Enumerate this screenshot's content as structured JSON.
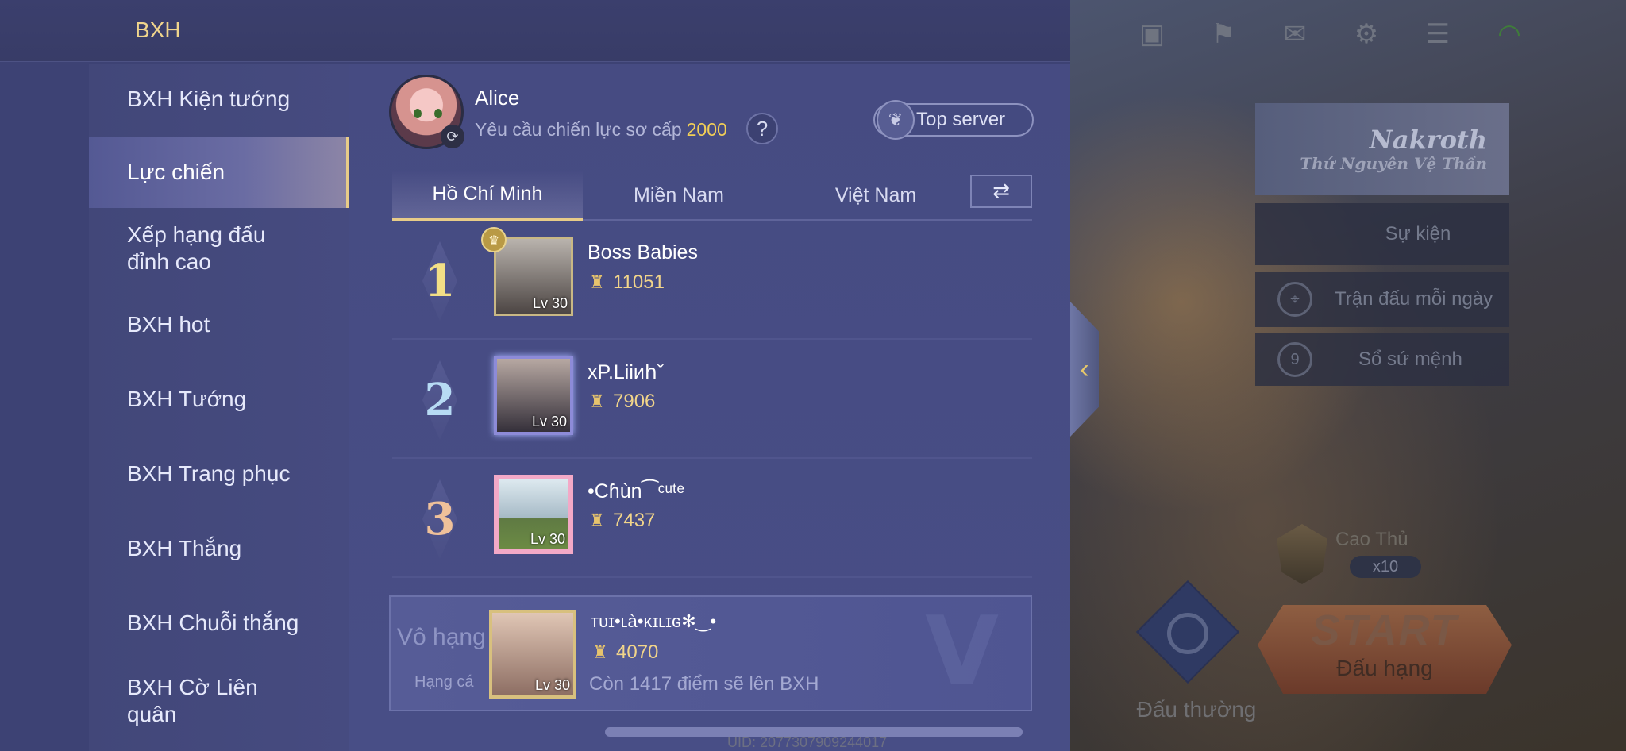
{
  "header": {
    "title": "BXH"
  },
  "sidebar": {
    "items": [
      {
        "label": "BXH Kiện tướng",
        "active": false
      },
      {
        "label": "Lực chiến",
        "active": true
      },
      {
        "label": "Xếp hạng đấu đỉnh cao",
        "active": false
      },
      {
        "label": "BXH hot",
        "active": false
      },
      {
        "label": "BXH Tướng",
        "active": false
      },
      {
        "label": "BXH Trang phục",
        "active": false
      },
      {
        "label": "BXH Thắng",
        "active": false
      },
      {
        "label": "BXH Chuỗi thắng",
        "active": false
      },
      {
        "label": "BXH Cờ Liên quân",
        "active": false
      }
    ]
  },
  "user": {
    "name": "Alice",
    "requirement_label": "Yêu cầu chiến lực sơ cấp",
    "requirement_value": "2000",
    "help_label": "?",
    "top_server_label": "Top server"
  },
  "tabs": [
    {
      "label": "Hồ Chí Minh",
      "active": true
    },
    {
      "label": "Miền Nam",
      "active": false
    },
    {
      "label": "Việt Nam",
      "active": false
    }
  ],
  "swap_icon": "⇄",
  "leaderboard": [
    {
      "rank": "1",
      "name": "Boss Babies",
      "score": "11051",
      "level": "Lv 30"
    },
    {
      "rank": "2",
      "name": "xP.Liiиհˇ",
      "score": "7906",
      "level": "Lv 30"
    },
    {
      "rank": "3",
      "name": "•Cɦùn⁀ᶜᵘᵗᵉ",
      "score": "7437",
      "level": "Lv 30"
    }
  ],
  "my_rank": {
    "status": "Vô hạng",
    "category": "Hạng cá",
    "name": "ᴛᴜɪ•ʟà•ᴋɪʟɪɢ✻‿•",
    "score": "4070",
    "level": "Lv 30",
    "progress_note": "Còn 1417 điểm sẽ lên BXH"
  },
  "background": {
    "hero_title": "Nakroth",
    "hero_subtitle": "Thứ Nguyên Vệ Thần",
    "event_label": "Sự kiện",
    "daily_label": "Trận đấu mỗi ngày",
    "fate_label": "Sổ sứ mệnh",
    "rank_name": "Cao Thủ",
    "rank_stars": "x10",
    "start_label": "START",
    "ranked_label": "Đấu hạng",
    "normal_label": "Đấu thường",
    "uid": "UID: 2077307909244017"
  },
  "colors": {
    "accent_gold": "#e8cc88",
    "score_yellow": "#f2cf56",
    "panel": "#3d4274"
  }
}
